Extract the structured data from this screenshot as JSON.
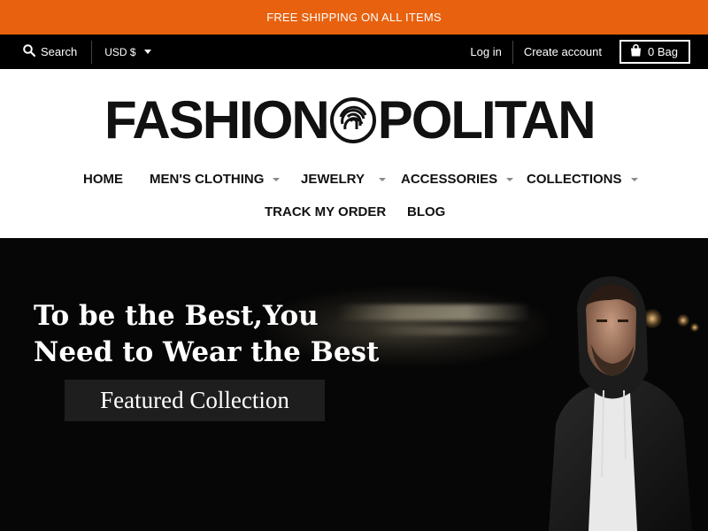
{
  "announcement": {
    "text": "FREE SHIPPING ON ALL ITEMS"
  },
  "topbar": {
    "search_label": "Search",
    "currency": "USD $",
    "login": "Log in",
    "create_account": "Create account",
    "bag_count": "0",
    "bag_label": "Bag"
  },
  "brand": {
    "logo_text_left": "FASHION",
    "logo_text_right": "POLITAN"
  },
  "nav": {
    "items": [
      {
        "label": "HOME",
        "has_dropdown": false
      },
      {
        "label": "MEN'S CLOTHING",
        "has_dropdown": true
      },
      {
        "label": "JEWELRY",
        "has_dropdown": true
      },
      {
        "label": "ACCESSORIES",
        "has_dropdown": true
      },
      {
        "label": "COLLECTIONS",
        "has_dropdown": true
      },
      {
        "label": "TRACK MY ORDER",
        "has_dropdown": false
      },
      {
        "label": "BLOG",
        "has_dropdown": false
      }
    ]
  },
  "hero": {
    "title_line1": "To be the Best,You",
    "title_line2": "Need to Wear the Best",
    "cta": "Featured Collection"
  },
  "colors": {
    "announcement_bg": "#e8610e",
    "topbar_bg": "#000000",
    "hero_bg": "#060606",
    "cta_bg": "#1e1e1e"
  },
  "icons": {
    "search": "search-icon",
    "currency_caret": "chevron-down-icon",
    "bag": "shopping-bag-icon",
    "logo_mark": "fingerprint-icon",
    "nav_caret": "chevron-down-icon"
  }
}
